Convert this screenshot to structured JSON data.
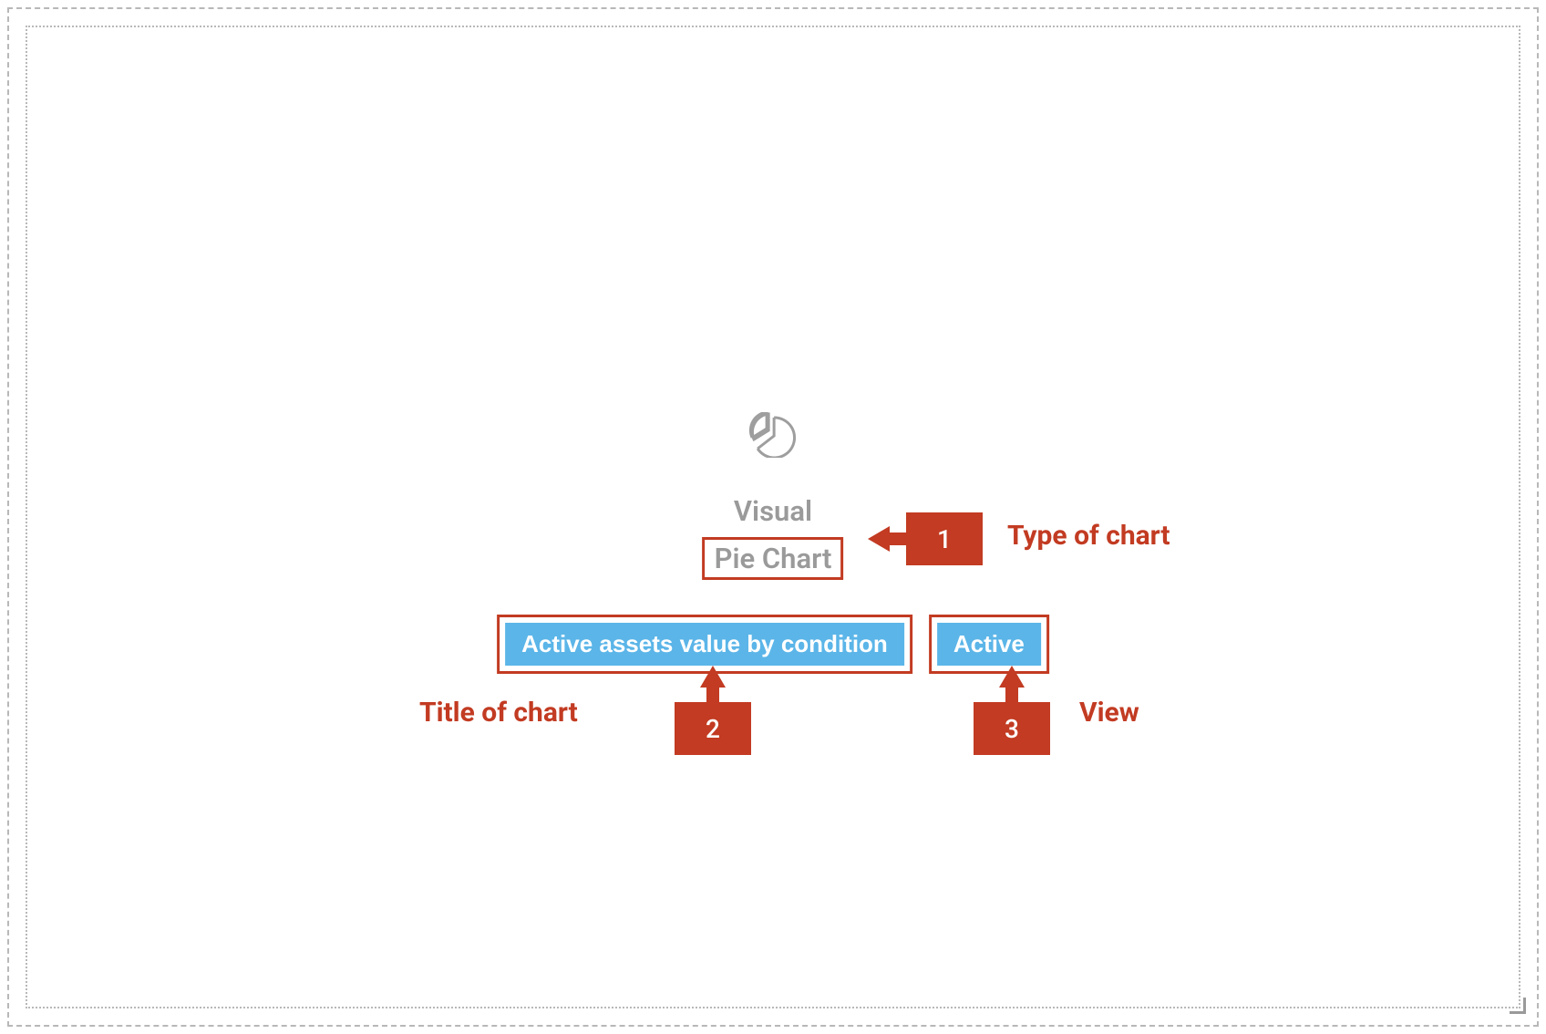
{
  "placeholder": {
    "icon_name": "pie-chart-icon",
    "section_label": "Visual",
    "chart_type": "Pie Chart",
    "title_pill": "Active assets value by condition",
    "view_pill": "Active"
  },
  "annotations": {
    "callout_1": {
      "number": "1",
      "label": "Type of chart"
    },
    "callout_2": {
      "number": "2",
      "label": "Title of chart"
    },
    "callout_3": {
      "number": "3",
      "label": "View"
    }
  },
  "colors": {
    "accent_annotation": "#c23b22",
    "pill_bg": "#5bb5e8",
    "muted_text": "#9a9a9a"
  }
}
